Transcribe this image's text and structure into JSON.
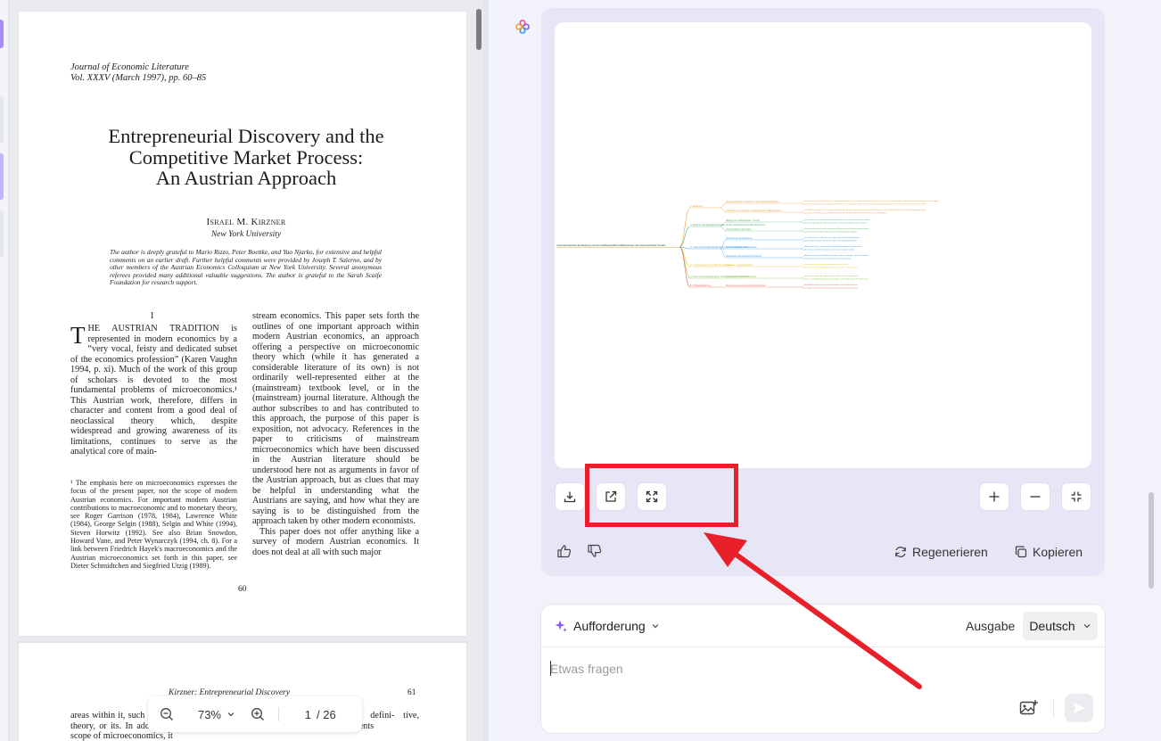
{
  "pdf": {
    "journal_line1": "Journal of Economic Literature",
    "journal_line2": "Vol. XXXV (March 1997), pp. 60–85",
    "title_line1": "Entrepreneurial Discovery and the",
    "title_line2": "Competitive Market Process:",
    "title_line3": "An Austrian Approach",
    "author": "Israel M. Kirzner",
    "affiliation": "New York University",
    "acknowledgment": "The author is deeply grateful to Mario Rizzo, Peter Boettke, and Yuo Njarko, for extensive and helpful comments on an earlier draft. Further helpful comments were provided by Joseph T. Salerno, and by other members of the Austrian Economics Colloquium at New York University. Several anonymous referees provided many additional valuable suggestions. The author is grateful to the Sarah Scaife Foundation for research support.",
    "section_number": "I",
    "dropcap": "T",
    "left_col_text": "HE AUSTRIAN TRADITION is represented in modern economics by a “very vocal, feisty and dedicated subset of the economics profession” (Karen Vaughn 1994, p. xi). Much of the work of this group of scholars is devoted to the most fundamental problems of microeconomics.¹ This Austrian work, therefore, differs in character and content from a good deal of neoclassical theory which, despite widespread and growing awareness of its limitations, continues to serve as the analytical core of main-",
    "footnote": "¹ The emphasis here on microeconomics expresses the focus of the present paper, not the scope of modern Austrian economics. For important modern Austrian contributions to macroeconomic and to monetary theory, see Roger Garrison (1978, 1984), Lawrence White (1984), George Selgin (1988), Selgin and White (1994), Steven Horwitz (1992). See also Brian Snowdon, Howard Vane, and Peter Wynarczyk (1994, ch. 8). For a link between Friedrich Hayek's macroeconomics and the Austrian microeconomics set forth in this paper, see Dieter Schmidtchen and Siegfried Utzig (1989).",
    "right_col_text": "stream economics. This paper sets forth the outlines of one important approach within modern Austrian economics, an approach offering a perspective on microeconomic theory which (while it has generated a considerable literature of its own) is not ordinarily well-represented either at the (mainstream) textbook level, or in the (mainstream) journal literature. Although the author subscribes to and has contributed to this approach, the purpose of this paper is exposition, not advocacy. References in the paper to criticisms of mainstream microeconomics which have been discussed in the Austrian literature should be understood here not as arguments in favor of the Austrian approach, but as clues that may be helpful in understanding what the Austrians are saying, and how what they are saying is to be distinguished from the approach taken by other modern economists.",
    "right_col_text2": "This paper does not offer anything like a survey of modern Austrian economics. It does not deal at all with such major",
    "page_number": "60",
    "page2_header": "Kirzner: Entrepreneurial Discovery",
    "page2_number": "61",
    "page2_left": "areas within it, such as its Austrian monetary theory, or its. In addition, within its chosen scope of microeconomics, it",
    "page2_right": "both Mises and separate, defini- tive, statements of their disagreements"
  },
  "zoom": {
    "level": "73%",
    "current_page": "1",
    "total_pages": "/ 26"
  },
  "mindmap": {
    "root": "Unternehmerische Entdeckung und der wettbewerbliche Marktprozess: Ein österreichischer Ansatz",
    "branches": [
      {
        "label": "1. Einleitung",
        "color": "#e8a13c",
        "children": [
          {
            "label": "Die österreichische Tradition in der Volkswirtschaftslehre",
            "leaves": [
              "Die österreichische Schule wird als eine engagierte Gruppe von Ökonomen betrachtet, die sich mit den grundlegenden Problemen der Mikroökonomie beschäftigen",
              "Sie unterscheidet sich in Charakter und Inhalt von der neoklassischen Theorie, die weiterhin den analytischen Kern der Mainstream-Ökonomie bildet"
            ]
          },
          {
            "label": "Darstellung der modernen österreichischen Mikroökonomie",
            "leaves": [
              "Der Aufsatz skizziert einen wichtigen Ansatz innerhalb der modernen österreichischen Ökonomie, der eine Perspektive auf die Mikroökonomie bietet",
              "Das Ziel ist Darstellung, nicht Befürwortung; Kritik am Mainstream dient als Hinweis zum Verständnis"
            ]
          }
        ]
      },
      {
        "label": "2. Kritik an der Gleichgewichtstheorie der neoklassischen Mikroökonomie",
        "color": "#58b36a",
        "children": [
          {
            "label": "Mängel der neoklassischen Theorie",
            "leaves": [
              "Die Theorie setzt Gleichgewichtszustände voraus, ohne den Prozess zu erklären",
              "Sie vernachlässigt die Rolle des Wissens und dessen Entdeckung im Markt"
            ]
          },
          {
            "label": "Österreichische Alternative",
            "leaves": [
              "Die österreichische Schule betont den Marktprozess als Entdeckungsverfahren",
              "Unternehmerische Wachsamkeit steht im Mittelpunkt der Analyse"
            ]
          }
        ]
      },
      {
        "label": "3. Unternehmerische Entdeckung und der Marktprozess",
        "color": "#3c9be8",
        "children": [
          {
            "label": "Die Rolle des Unternehmers",
            "leaves": [
              "Der Unternehmer entdeckt zuvor unbemerkte Gewinnmöglichkeiten",
              "Diese Entdeckungen treiben den Markt in Richtung Koordination"
            ]
          },
          {
            "label": "Unternehmerische Wachsamkeit",
            "leaves": [
              "Wachsamkeit ist keine Ressource, die gezielt eingesetzt werden kann",
              "Sie erklärt, wie Fehler im Markt erkannt und korrigiert werden"
            ]
          },
          {
            "label": "Wettbewerb als dynamischer Prozess",
            "leaves": [
              "Wettbewerb wird als Rivalität um Entdeckungen verstanden, nicht als Zustand",
              "Freier Markteintritt ist die entscheidende Voraussetzung"
            ]
          }
        ]
      },
      {
        "label": "4. Ungleichgewicht und der Marktprozess",
        "color": "#e8c33c",
        "children": [
          {
            "label": "Natur des Ungleichgewichts",
            "leaves": [
              "Ungleichgewicht ist der Normalzustand realer Märkte",
              "Preisunterschiede signalisieren Gewinnchancen für Unternehmer"
            ]
          }
        ]
      },
      {
        "label": "5. Kritik und Verteidigung der österreichischen Sichtweise",
        "color": "#8ac24a",
        "children": [
          {
            "label": "Gegenargumente und Antworten",
            "leaves": [
              "Kritiker bezweifeln die systematische Tendenz zum Gleichgewicht",
              "Kirzner verteidigt die Koordinationstendenz unternehmerischer Entdeckungen"
            ]
          }
        ]
      },
      {
        "label": "6. Schlussfolgerung",
        "color": "#e86a5c",
        "children": [
          {
            "label": "Bedeutung des österreichischen Ansatzes",
            "leaves": [
              "Der Ansatz bietet ein besseres Verständnis realer Marktprozesse",
              "Er ergänzt die Mikroökonomie um die Dimension der Entdeckung"
            ]
          }
        ]
      }
    ]
  },
  "actions": {
    "regenerate": "Regenerieren",
    "copy": "Kopieren"
  },
  "input": {
    "prompt_label": "Aufforderung",
    "output_label": "Ausgabe",
    "language": "Deutsch",
    "placeholder": "Etwas fragen"
  },
  "colors": {
    "accent": "#8b5cf6",
    "highlight": "#e8202a",
    "card": "#e6e6f7"
  }
}
